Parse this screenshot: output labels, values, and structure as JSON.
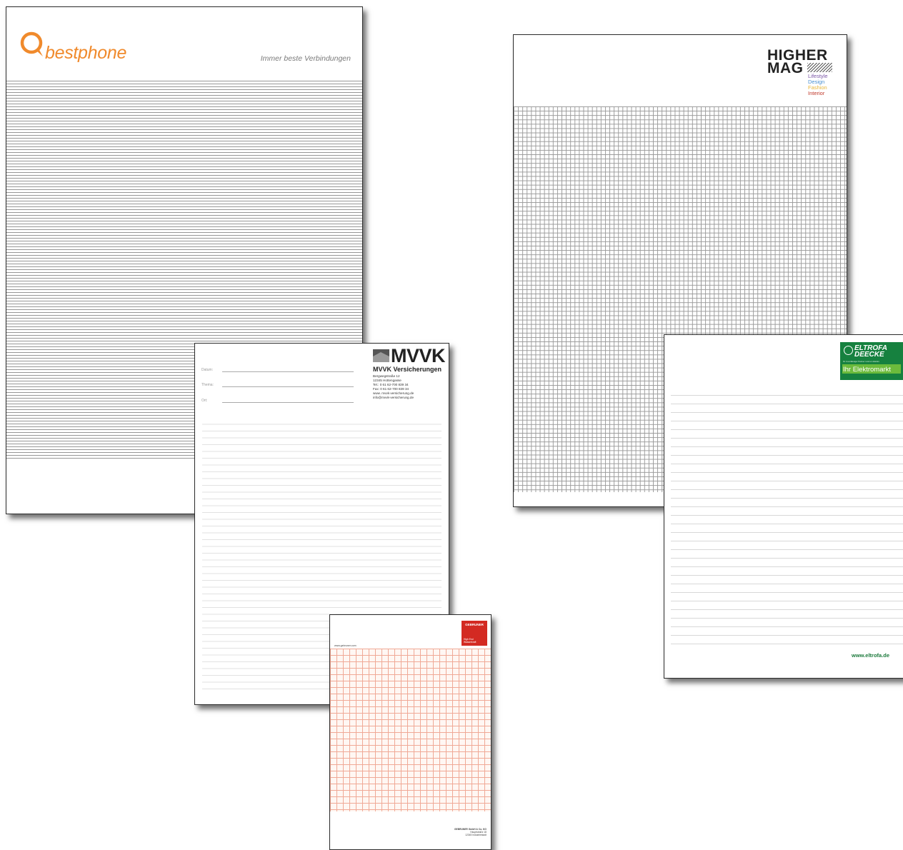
{
  "bestphone": {
    "brand": "bestphone",
    "tagline": "Immer beste Verbindungen",
    "icon": "speech-bubble-q-logo",
    "brand_color": "#f08a2c"
  },
  "mvvk": {
    "brand": "MVVK",
    "company": "MVVK Versicherungen",
    "address_lines": [
      "Bergwegstraße 12",
      "12345 Hottengasse",
      "Tel.: 0 61 62-700 839 34",
      "Fax: 0 61 62-700 839 34",
      "www. mvvk-versicherung.de",
      "info@mvvk-versicherung.de"
    ],
    "fields": [
      "Datum:",
      "Thema:",
      "Ort:"
    ]
  },
  "gebruner": {
    "brand": "GEBRUNER",
    "tagline_lines": [
      "High End",
      "Wasserkraft"
    ],
    "url": "www.gebruner.com",
    "footer_lines": [
      "GEBRUNER GmbH & Co. KG",
      "Hauptstraße 18",
      "12345 Industriestadt"
    ],
    "brand_color": "#d32a22"
  },
  "higher_mag": {
    "title_line1": "HIGHER",
    "title_line2": "MAG",
    "categories": [
      {
        "label": "Lifestyle",
        "color": "#7a55a6"
      },
      {
        "label": "Design",
        "color": "#4a90d2"
      },
      {
        "label": "Fashion",
        "color": "#e9b638"
      },
      {
        "label": "Interior",
        "color": "#c0392b"
      }
    ]
  },
  "eltrofa": {
    "brand_line1": "ELTROFA",
    "brand_line2": "DEECKE",
    "small_text": "Ihr zuverlässiger Partner rund um Elektro",
    "subline": "Ihr Elektromarkt",
    "url": "www.eltrofa.de",
    "brand_color": "#16813f"
  }
}
